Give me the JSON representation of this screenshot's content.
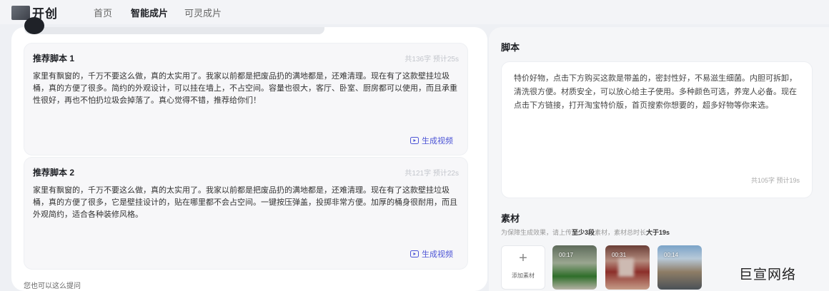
{
  "app": {
    "name": "开创"
  },
  "nav": {
    "items": [
      "首页",
      "智能成片",
      "可灵成片"
    ],
    "active_index": 1
  },
  "left": {
    "cards": [
      {
        "title": "推荐脚本 1",
        "meta": "共136字 预计25s",
        "body": "家里有飘窗的，千万不要这么做，真的太实用了。我家以前都是把废品扔的满地都是，还难清理。现在有了这款壁挂垃圾桶，真的方便了很多。简约的外观设计，可以挂在墙上，不占空间。容量也很大，客厅、卧室、厨房都可以使用，而且承重性很好，再也不怕扔垃圾会掉落了。真心觉得不错，推荐给你们！",
        "action": "生成视频"
      },
      {
        "title": "推荐脚本 2",
        "meta": "共121字 预计22s",
        "body": "家里有飘窗的，千万不要这么做，真的太实用了。我家以前都是把废品扔的满地都是，还难清理。现在有了这款壁挂垃圾桶，真的方便了很多，它是壁挂设计的，贴在哪里都不会占空间。一键按压弹盖，投掷非常方便。加厚的桶身很耐用，而且外观简约，适合各种装修风格。",
        "action": "生成视频"
      }
    ],
    "hint": "您也可以这么提问"
  },
  "right": {
    "script_title": "脚本",
    "script_text": "特价好物，点击下方购买这款是带盖的，密封性好，不易滋生细菌。内胆可拆卸，清洗很方便。材质安全，可以放心给主子使用。多种颜色可选，养宠人必备。现在点击下方链接，打开淘宝特价版，首页搜索你想要的，超多好物等你来选。",
    "script_meta": "共105字 预计19s",
    "material_title": "素材",
    "material_hint": {
      "prefix": "为保障生成效果，请上传",
      "count": "至少3段",
      "middle": "素材，素材总时长",
      "duration": "大于19s"
    },
    "add_label": "添加素材",
    "add_icon": "plus-icon",
    "thumbs": [
      {
        "duration": "00:17"
      },
      {
        "duration": "00:31"
      },
      {
        "duration": "00:14"
      }
    ]
  },
  "watermark": "巨宣网络",
  "colors": {
    "accent": "#4d55d6"
  }
}
